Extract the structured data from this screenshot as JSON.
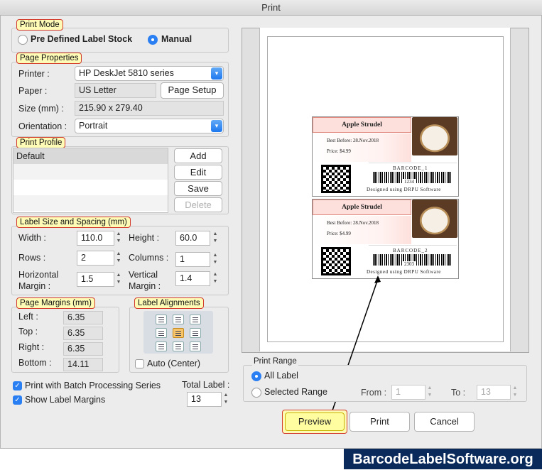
{
  "window": {
    "title": "Print"
  },
  "print_mode": {
    "title": "Print Mode",
    "options": [
      "Pre Defined Label Stock",
      "Manual"
    ],
    "selected": "Manual"
  },
  "page_properties": {
    "title": "Page Properties",
    "printer_label": "Printer :",
    "printer_value": "HP DeskJet 5810 series",
    "paper_label": "Paper :",
    "paper_value": "US Letter",
    "page_setup_button": "Page Setup",
    "size_label": "Size (mm) :",
    "size_value": "215.90 x 279.40",
    "orientation_label": "Orientation :",
    "orientation_value": "Portrait"
  },
  "print_profile": {
    "title": "Print Profile",
    "items": [
      "Default"
    ],
    "add": "Add",
    "edit": "Edit",
    "save": "Save",
    "delete": "Delete"
  },
  "label_size": {
    "title": "Label Size and Spacing (mm)",
    "width_label": "Width :",
    "width": "110.0",
    "height_label": "Height :",
    "height": "60.0",
    "rows_label": "Rows :",
    "rows": "2",
    "columns_label": "Columns :",
    "columns": "1",
    "hmargin_label_1": "Horizontal",
    "hmargin_label_2": "Margin :",
    "hmargin": "1.5",
    "vmargin_label_1": "Vertical",
    "vmargin_label_2": "Margin :",
    "vmargin": "1.4"
  },
  "page_margins": {
    "title": "Page Margins (mm)",
    "left_label": "Left :",
    "left": "6.35",
    "top_label": "Top :",
    "top": "6.35",
    "right_label": "Right :",
    "right": "6.35",
    "bottom_label": "Bottom :",
    "bottom": "14.11"
  },
  "label_alignments": {
    "title": "Label Alignments",
    "selected": "center",
    "auto_center_label": "Auto (Center)",
    "auto_center_checked": false
  },
  "options": {
    "batch_label": "Print with Batch Processing Series",
    "batch_checked": true,
    "margins_label": "Show Label Margins",
    "margins_checked": true,
    "total_label_caption": "Total Label :",
    "total_label": "13"
  },
  "preview": {
    "labels": [
      {
        "name": "Apple Strudel",
        "best_before": "Best Before: 28.Nov.2018",
        "price": "Price: $4.99",
        "barcode_title": "BARCODE_1",
        "barcode_value": "1234",
        "footer": "Designed using DRPU Software"
      },
      {
        "name": "Apple Strudel",
        "best_before": "Best Before: 28.Nov.2018",
        "price": "Price: $4.99",
        "barcode_title": "BARCODE_2",
        "barcode_value": "2303",
        "footer": "Designed using DRPU Software"
      }
    ]
  },
  "print_range": {
    "title": "Print Range",
    "all_label": "All Label",
    "selected_range": "Selected Range",
    "selected": "All Label",
    "from_label": "From :",
    "from": "1",
    "to_label": "To :",
    "to": "13"
  },
  "buttons": {
    "preview": "Preview",
    "print": "Print",
    "cancel": "Cancel"
  },
  "branding": "BarcodeLabelSoftware.org",
  "colors": {
    "accent": "#2a7ff3",
    "highlight": "#fdfbb6",
    "brand_bg": "#0a2a5b"
  }
}
